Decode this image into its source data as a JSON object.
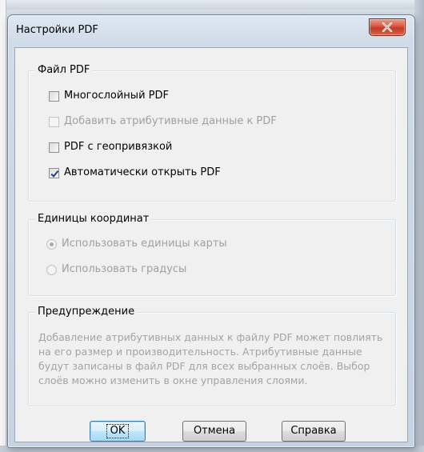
{
  "dialog": {
    "title": "Настройки PDF"
  },
  "pdf_file": {
    "title": "Файл PDF",
    "options": [
      {
        "label": "Многослойный PDF",
        "checked": false,
        "enabled": true
      },
      {
        "label": "Добавить атрибутивные данные к PDF",
        "checked": false,
        "enabled": false
      },
      {
        "label": "PDF с геопривязкой",
        "checked": false,
        "enabled": true
      },
      {
        "label": "Автоматически открыть PDF",
        "checked": true,
        "enabled": true
      }
    ]
  },
  "coords": {
    "title": "Единицы координат",
    "options": [
      {
        "label": "Использовать единицы карты",
        "selected": true,
        "enabled": false
      },
      {
        "label": "Использовать градусы",
        "selected": false,
        "enabled": false
      }
    ]
  },
  "warning": {
    "title": "Предупреждение",
    "text": "Добавление атрибутивных данных к файлу PDF может повлиять на его размер и производительность. Атрибутивные данные будут записаны в файл PDF для всех выбранных слоёв. Выбор слоёв можно изменить в окне управления слоями."
  },
  "buttons": {
    "ok": "OK",
    "cancel": "Отмена",
    "help": "Справка"
  },
  "colors": {
    "close_button": "#d2553e",
    "disabled_text": "#a0a0a0",
    "default_button_border": "#3c7fb1"
  }
}
